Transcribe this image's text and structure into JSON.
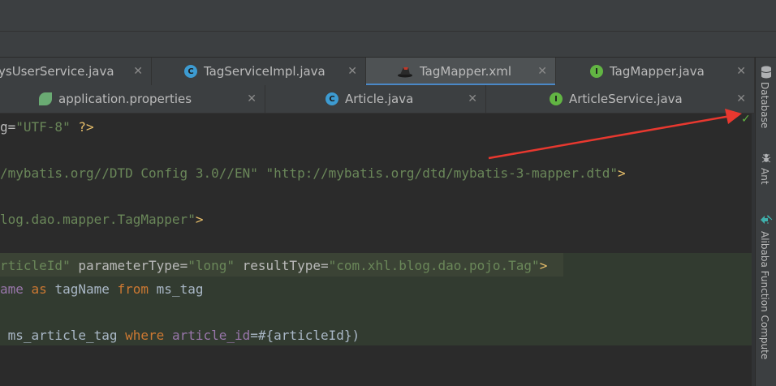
{
  "tabs_row1": [
    {
      "label": "ysUserService.java",
      "icon": "none"
    },
    {
      "label": "TagServiceImpl.java",
      "icon": "class-icon"
    },
    {
      "label": "TagMapper.xml",
      "icon": "mybatis-icon",
      "active": true
    },
    {
      "label": "TagMapper.java",
      "icon": "interface-icon"
    }
  ],
  "tabs_row2": [
    {
      "label": "application.properties",
      "icon": "spring-leaf-icon"
    },
    {
      "label": "Article.java",
      "icon": "class-icon"
    },
    {
      "label": "ArticleService.java",
      "icon": "interface-icon"
    }
  ],
  "close_glyph": "✕",
  "icon_glyphs": {
    "class": "C",
    "interface": "I"
  },
  "right_sidebar": {
    "database": "Database",
    "ant": "Ant",
    "alibaba": "Alibaba Function Compute"
  },
  "status_check": "✓",
  "code": {
    "l1": {
      "a": "g=",
      "b": "\"UTF-8\"",
      "c": " ?>"
    },
    "l2": {
      "a": "/mybatis.org//DTD Config 3.0//EN\"",
      "b": " ",
      "c": "\"http://mybatis.org/dtd/mybatis-3-mapper.dtd\"",
      "d": ">"
    },
    "l3": {
      "a": "log.dao.mapper.TagMapper\"",
      "b": ">"
    },
    "l4": {
      "a": "rticleId\"",
      "b": " parameterType=",
      "c": "\"long\"",
      "d": " resultType=",
      "e": "\"com.xhl.blog.dao.pojo.Tag\"",
      "f": ">"
    },
    "l5": {
      "a": "ame",
      "b": " as ",
      "c": "tagName",
      "d": " from ",
      "e": "ms_tag"
    },
    "l6": {
      "a": " ms_article_tag",
      "b": " where ",
      "c": "article_id",
      "d": "=#{articleId})"
    }
  },
  "colors": {
    "accent": "#4a88c7",
    "annotation_arrow": "#e8382f",
    "string": "#6a8759",
    "keyword": "#cc7832"
  }
}
